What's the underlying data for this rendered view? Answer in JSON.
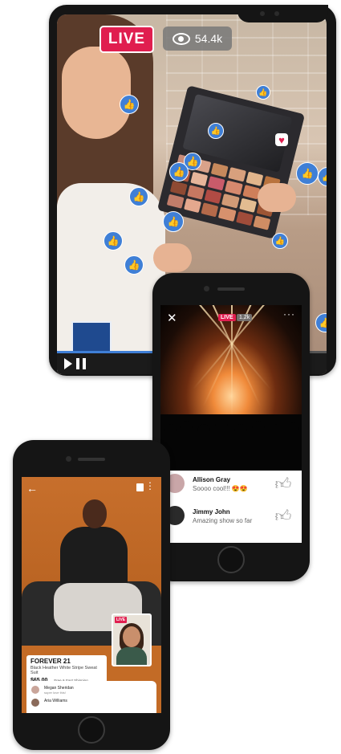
{
  "tablet": {
    "live_label": "LIVE",
    "viewer_count": "54.4k",
    "progress_fraction": 0.52,
    "icons": [
      "eye-icon",
      "like-icon",
      "heart-icon",
      "play-icon",
      "pause-icon"
    ]
  },
  "concert_phone": {
    "live_label": "LIVE",
    "viewer_count": "1.2k",
    "comments": [
      {
        "name": "Allison Gray",
        "text": "Soooo cool!!! 😍😍"
      },
      {
        "name": "Jimmy John",
        "text": "Amazing show so far"
      }
    ]
  },
  "fashion_phone": {
    "pip_live_label": "LIVE",
    "product": {
      "brand": "FOREVER 21",
      "name": "Black Heather White Stripe Sweat Suit",
      "price": "$65.00",
      "shipping": "Free & Fast Shipping"
    },
    "chat": [
      {
        "name": "Megan Sheridan",
        "text": "super love this!"
      },
      {
        "name": "Aria Williams",
        "text": ""
      }
    ]
  },
  "colors": {
    "live_red": "#e01e4f",
    "like_blue": "#3f7fd6",
    "device_black": "#151515"
  }
}
